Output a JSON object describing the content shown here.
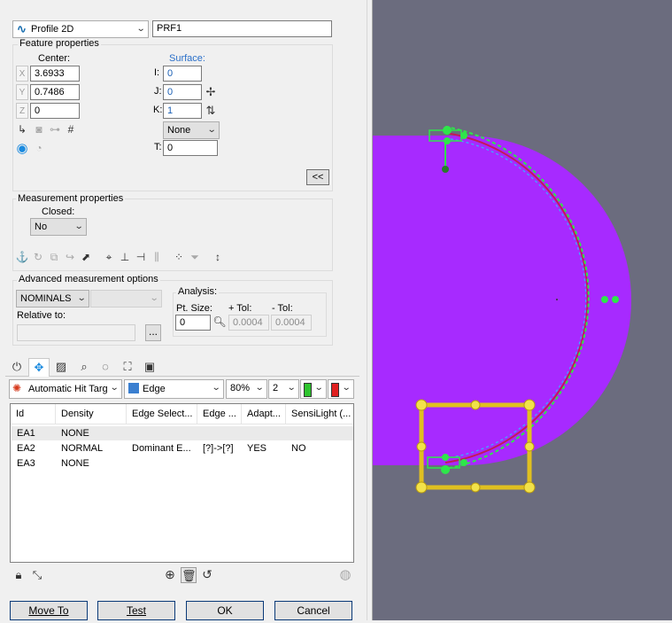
{
  "header": {
    "feature_type": "Profile 2D",
    "feature_id": "PRF1"
  },
  "feature_properties": {
    "title": "Feature properties",
    "center_label": "Center:",
    "surface_label": "Surface:",
    "x_axis": "X",
    "y_axis": "Y",
    "z_axis": "Z",
    "x_value": "3.6933",
    "y_value": "0.7486",
    "z_value": "0",
    "i_label": "I:",
    "j_label": "J:",
    "k_label": "K:",
    "t_label": "T:",
    "i_value": "0",
    "j_value": "0",
    "k_value": "1",
    "surface_dropdown": "None",
    "t_value": "0",
    "collapse_button": "<<"
  },
  "measurement_properties": {
    "title": "Measurement properties",
    "closed_label": "Closed:",
    "closed_value": "No"
  },
  "advanced": {
    "title": "Advanced measurement options",
    "mode_value": "NOMINALS",
    "relative_label": "Relative to:",
    "relative_button": "...",
    "analysis_label": "Analysis:",
    "pt_size_label": "Pt. Size:",
    "plus_tol_label": "+ Tol:",
    "minus_tol_label": "- Tol:",
    "pt_size_value": "0",
    "plus_tol_value": "0.0004",
    "minus_tol_value": "0.0004"
  },
  "hit_toolbar": {
    "target_value": "Automatic Hit Targ",
    "edge_value": "Edge",
    "percent_value": "80%",
    "count_value": "2"
  },
  "table": {
    "columns": [
      "Id",
      "Density",
      "Edge Select...",
      "Edge ...",
      "Adapt...",
      "SensiLight (..."
    ],
    "rows": [
      [
        "EA1",
        "NONE",
        "",
        "",
        "",
        ""
      ],
      [
        "EA2",
        "NORMAL",
        "Dominant E...",
        "[?]->[?]",
        "YES",
        "NO"
      ],
      [
        "EA3",
        "NONE",
        "",
        "",
        "",
        ""
      ]
    ]
  },
  "footer": {
    "move_to": "Move To",
    "test": "Test",
    "ok": "OK",
    "cancel": "Cancel"
  },
  "colors": {
    "part": "#a72aff",
    "viewport": "#6b6c7e",
    "curve": "#c21a5a",
    "offset": "#2ee64a",
    "handles": "#e0c020"
  }
}
